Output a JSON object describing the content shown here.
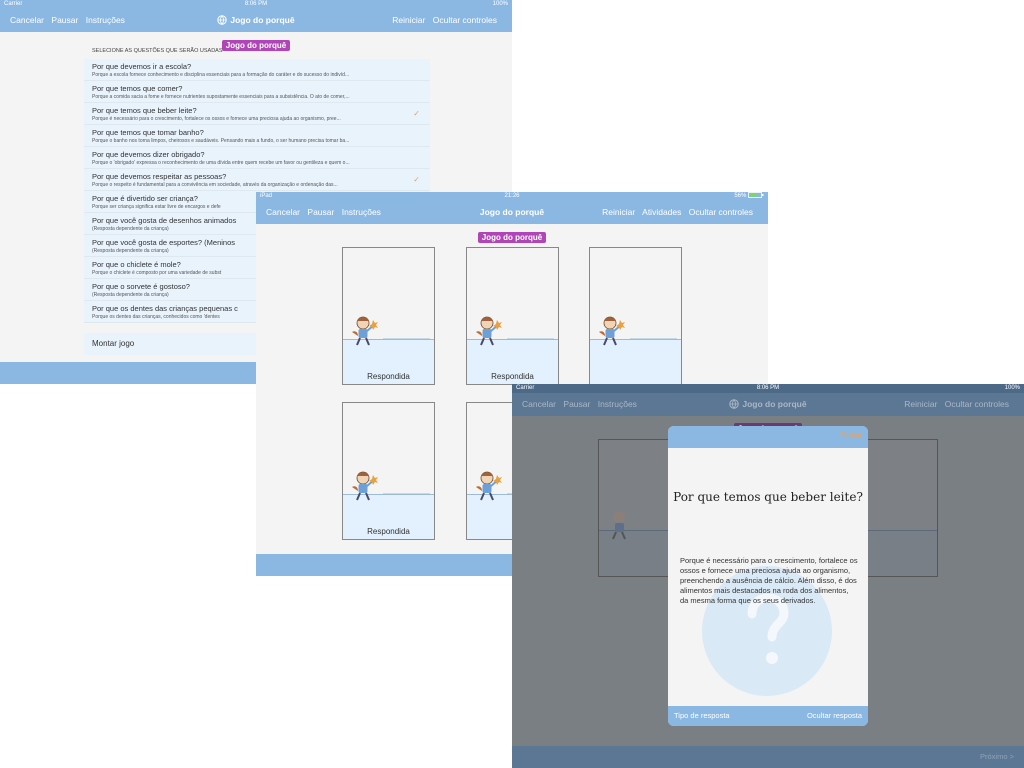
{
  "screen1": {
    "status": {
      "carrier": "Carrier",
      "time": "8:06 PM",
      "battery": "100%"
    },
    "nav": {
      "cancel": "Cancelar",
      "pause": "Pausar",
      "instructions": "Instruções",
      "title": "Jogo do porquê",
      "restart": "Reiniciar",
      "hide_controls": "Ocultar controles"
    },
    "pill": "Jogo do porquê",
    "section_header": "SELECIONE AS QUESTÕES QUE SERÃO USADAS",
    "questions": [
      {
        "title": "Por que devemos ir a escola?",
        "subtitle": "Porque a escola fornece conhecimento e disciplina essenciais para a formação do caráter e do sucesso do indivíd...",
        "checked": false
      },
      {
        "title": "Por que temos que comer?",
        "subtitle": "Porque a comida sacia a fome e fornece nutrientes supostamente essenciais para a subsistência. O ato de comer,...",
        "checked": false
      },
      {
        "title": "Por que temos que beber leite?",
        "subtitle": "Porque é necessário para o crescimento, fortalece os ossos e fornece uma preciosa ajuda ao organismo, pree...",
        "checked": true
      },
      {
        "title": "Por que temos que tomar banho?",
        "subtitle": "Porque o banho nos torna limpos, cheirosos e saudáveis. Pensando mais a fundo, o ser humano precisa tomar ba...",
        "checked": false
      },
      {
        "title": "Por que devemos dizer obrigado?",
        "subtitle": "Porque o 'obrigado' expressa o reconhecimento de uma dívida entre quem recebe um favor ou gentileza e quem o...",
        "checked": false
      },
      {
        "title": "Por que devemos respeitar as pessoas?",
        "subtitle": "Porque o respeito é fundamental para a convivência em sociedade, através da organização e ordenação das...",
        "checked": true
      },
      {
        "title": "Por que é divertido ser criança?",
        "subtitle": "Porque ser criança significa estar livre de encargos e defe",
        "checked": false
      },
      {
        "title": "Por que você gosta de desenhos animados",
        "subtitle": "(Resposta dependente da criança)",
        "checked": false
      },
      {
        "title": "Por que você gosta de esportes? (Meninos",
        "subtitle": "(Resposta dependente da criança)",
        "checked": false
      },
      {
        "title": "Por que o chiclete é mole?",
        "subtitle": "Porque o chiclete é composto por uma variedade de subst",
        "checked": false
      },
      {
        "title": "Por que o sorvete é gostoso?",
        "subtitle": "(Resposta dependente da criança)",
        "checked": false
      },
      {
        "title": "Por que os dentes das crianças pequenas c",
        "subtitle": "Porque os dentes das crianças, conhecidos como 'dentes",
        "checked": false
      }
    ],
    "build_game": "Montar jogo"
  },
  "screen2": {
    "status": {
      "carrier": "iPad",
      "time": "21:26",
      "battery": "56%"
    },
    "nav": {
      "cancel": "Cancelar",
      "pause": "Pausar",
      "instructions": "Instruções",
      "title": "Jogo do porquê",
      "restart": "Reiniciar",
      "activities": "Atividades",
      "hide_controls": "Ocultar controles"
    },
    "pill": "Jogo do porquê",
    "cards": [
      {
        "label": "Respondida"
      },
      {
        "label": "Respondida"
      },
      {
        "label": ""
      },
      {
        "label": "Respondida"
      },
      {
        "label": ""
      }
    ]
  },
  "screen3": {
    "status": {
      "carrier": "Carrier",
      "time": "8:06 PM",
      "battery": "100%"
    },
    "nav": {
      "cancel": "Cancelar",
      "pause": "Pausar",
      "instructions": "Instruções",
      "title": "Jogo do porquê",
      "restart": "Reiniciar",
      "hide_controls": "Ocultar controles"
    },
    "pill": "Jogo do porquê",
    "modal": {
      "close": "Fechar",
      "question": "Por que temos que beber leite?",
      "answer": "Porque é necessário para o crescimento, fortalece os ossos e fornece uma preciosa ajuda ao organismo, preenchendo a ausência de cálcio. Além disso, é dos alimentos mais destacados na roda dos alimentos, da mesma forma que os seus derivados.",
      "answer_type": "Tipo de resposta",
      "hide_answer": "Ocultar resposta"
    },
    "next": "Próximo >"
  },
  "colors": {
    "nav_blue": "#8bb8e3",
    "pill_purple": "#b045b8",
    "check_orange": "#f0a050",
    "row_bg": "#e8f3fc"
  }
}
